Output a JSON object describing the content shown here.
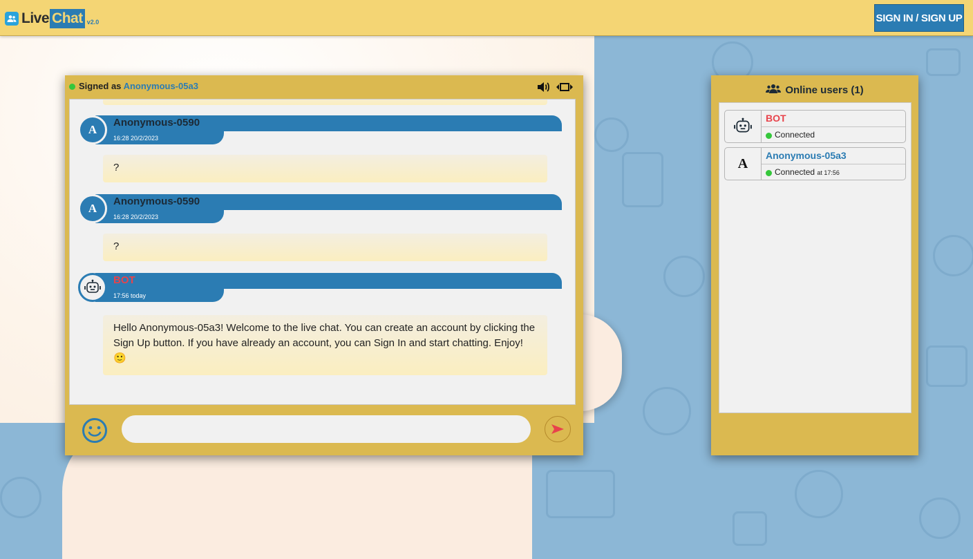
{
  "app": {
    "logo_live": "Live",
    "logo_chat": "Chat",
    "logo_version": "v2.0",
    "signin_label": "SIGN IN / SIGN UP"
  },
  "chat": {
    "signed_prefix": "Signed as",
    "signed_user": "Anonymous-05a3",
    "messages": [
      {
        "avatar": "A",
        "name": "Anonymous-0590",
        "time": "16:28 20/2/2023",
        "text": "?"
      },
      {
        "avatar": "A",
        "name": "Anonymous-0590",
        "time": "16:28 20/2/2023",
        "text": "?"
      },
      {
        "avatar": "robot-icon",
        "name": "BOT",
        "time": "17:56 today",
        "text": "Hello Anonymous-05a3! Welcome to the live chat. You can create an account by clicking the Sign Up button. If you have already an account, you can Sign In and start chatting. Enjoy! 🙂"
      }
    ],
    "input_placeholder": ""
  },
  "users": {
    "title": "Online users (1)",
    "list": [
      {
        "avatar": "robot-icon",
        "name": "BOT",
        "status": "Connected",
        "at": ""
      },
      {
        "avatar": "A",
        "name": "Anonymous-05a3",
        "status": "Connected",
        "at": "at 17:56"
      }
    ]
  },
  "colors": {
    "header_bg": "#f4d574",
    "panel_bg": "#dbb950",
    "accent_blue": "#2b7cb3",
    "bot_red": "#e8434b",
    "online_green": "#35c73b"
  }
}
